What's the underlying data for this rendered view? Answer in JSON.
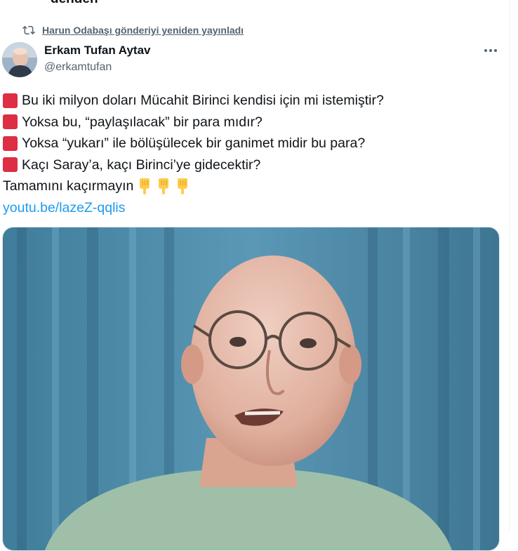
{
  "prev_tweet_tail": "dendeh",
  "retweet": {
    "label": "Harun Odabaşı gönderiyi yeniden yayınladı",
    "icon": "retweet-icon"
  },
  "author": {
    "display_name": "Erkam Tufan Aytav",
    "handle": "@erkamtufan"
  },
  "more_icon": "more-horizontal-icon",
  "tweet": {
    "lines": [
      " Bu iki milyon doları Mücahit Birinci kendisi için mi istemiştir?",
      "Yoksa bu, “paylaşılacak” bir para mıdır?",
      "Yoksa “yukarı” ile bölüşülecek bir ganimet midir bu para?",
      "Kaçı Saray’a, kaçı Birinci’ye gidecektir?"
    ],
    "cta": "Tamamını kaçırmayın",
    "link": "youtu.be/lazeZ-qqlis"
  },
  "colors": {
    "link": "#1d9bf0",
    "muted": "#536471",
    "red_square": "#dd2e44"
  },
  "icons": [
    "red-square-icon",
    "pointing-down-hand-icon"
  ]
}
